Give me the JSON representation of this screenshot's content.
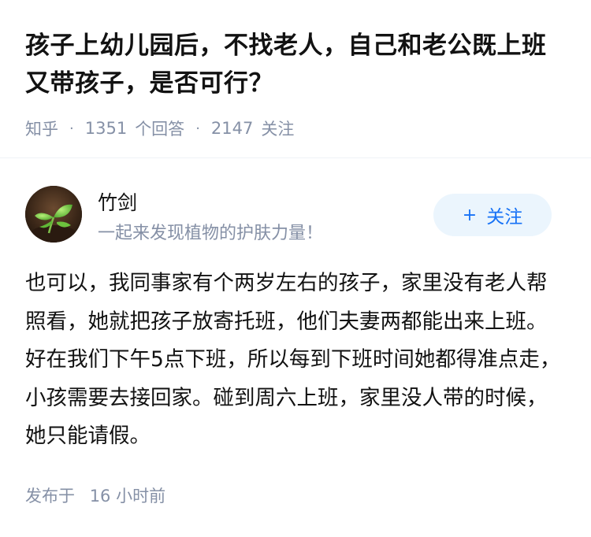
{
  "question": {
    "title": "孩子上幼儿园后，不找老人，自己和老公既上班又带孩子，是否可行？",
    "source": "知乎",
    "answer_count": "1351",
    "answer_label": "个回答",
    "follower_count": "2147",
    "follower_label": "关注",
    "separator": "·"
  },
  "author": {
    "name": "竹剑",
    "headline": "一起来发现植物的护肤力量！",
    "avatar_icon": "plant-sprout-avatar"
  },
  "follow_button": {
    "plus": "+",
    "label": "关注"
  },
  "answer": {
    "content": "也可以，我同事家有个两岁左右的孩子，家里没有老人帮照看，她就把孩子放寄托班，他们夫妻两都能出来上班。好在我们下午5点下班，所以每到下班时间她都得准点走，小孩需要去接回家。碰到周六上班，家里没人带的时候，她只能请假。",
    "time_label": "发布于",
    "time_value": "16 小时前"
  },
  "colors": {
    "title": "#121212",
    "meta": "#8590a6",
    "accent": "#1772f6",
    "button_bg": "#ebf5fd"
  }
}
